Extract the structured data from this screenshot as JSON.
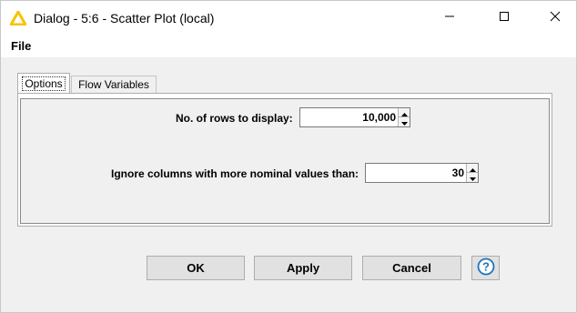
{
  "window": {
    "title": "Dialog - 5:6 - Scatter Plot (local)",
    "icon": "knime-warning-triangle-icon",
    "controls": [
      "minimize-icon",
      "maximize-icon",
      "close-icon"
    ]
  },
  "menu": {
    "file_label": "File"
  },
  "tabs": [
    {
      "label": "Options",
      "selected": true
    },
    {
      "label": "Flow Variables",
      "selected": false
    }
  ],
  "options": {
    "rows_label": "No. of rows to display:",
    "rows_value": "10,000",
    "nominal_label": "Ignore columns with more nominal values than:",
    "nominal_value": "30"
  },
  "buttons": {
    "ok": "OK",
    "apply": "Apply",
    "cancel": "Cancel",
    "help_icon": "help-question-icon"
  },
  "colors": {
    "warning_yellow": "#f5c400",
    "help_blue": "#1e73be"
  }
}
